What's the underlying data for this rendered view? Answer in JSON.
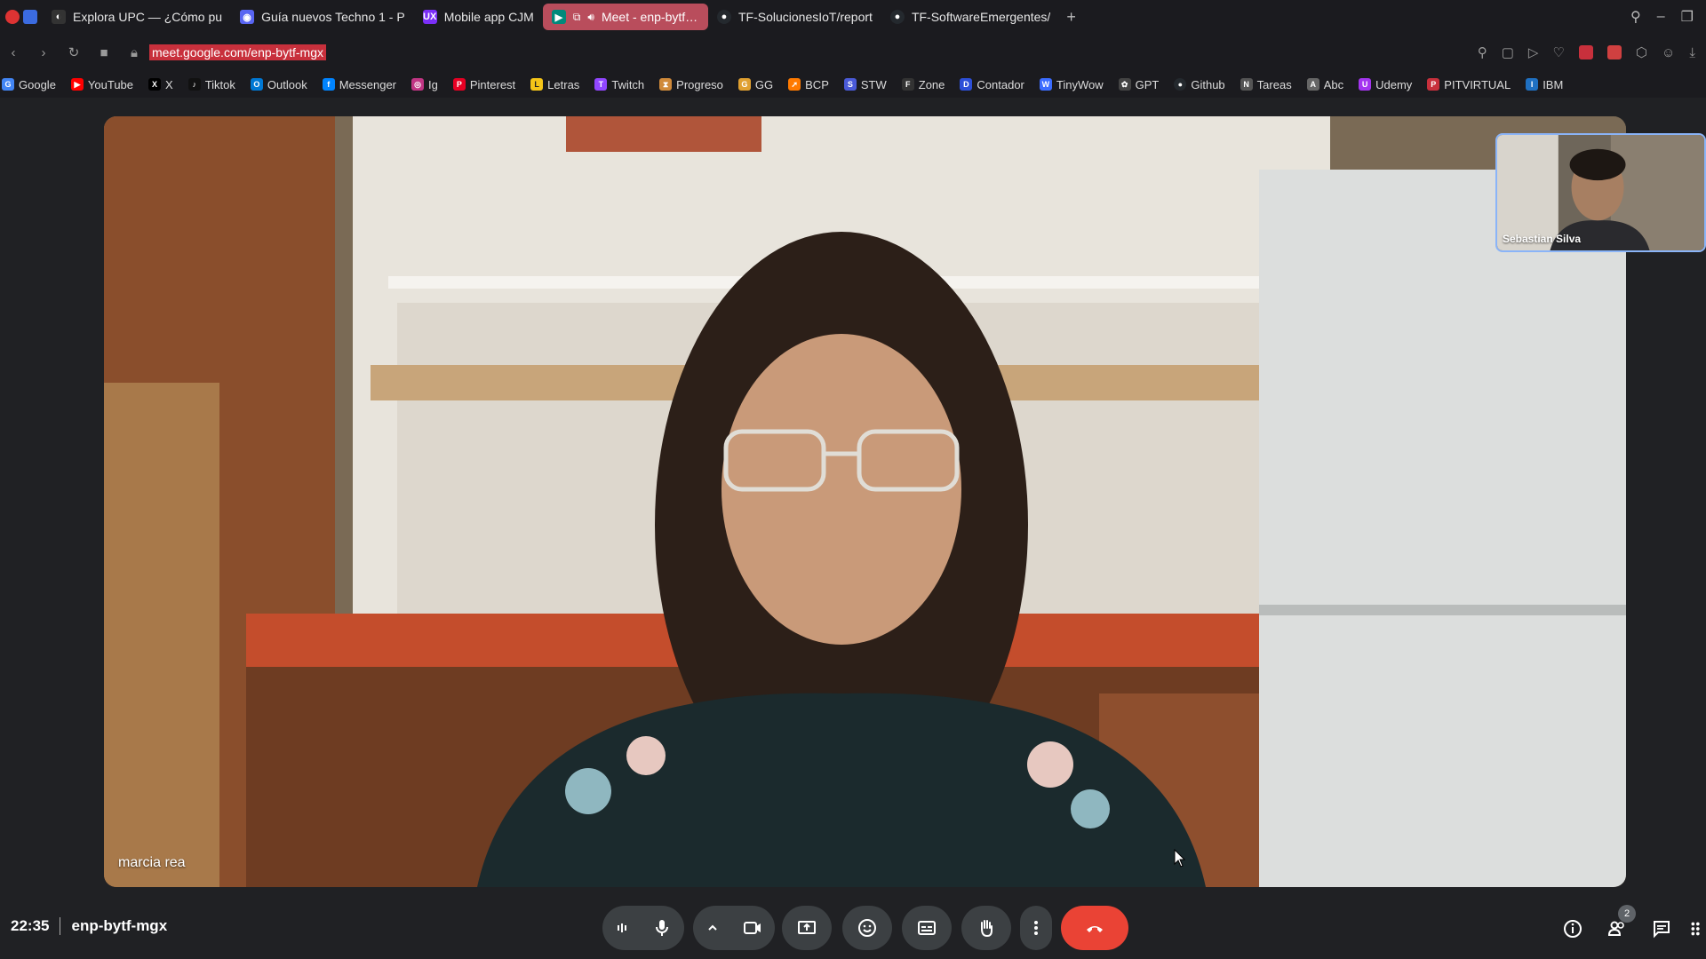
{
  "browser": {
    "tabs": [
      {
        "title": "Explora UPC — ¿Cómo pu",
        "icon": "upc-icon",
        "color": "#1a1a1a"
      },
      {
        "title": "Guía nuevos Techno 1 - P",
        "icon": "discord-icon",
        "color": "#5865f2"
      },
      {
        "title": "Mobile app CJM",
        "icon": "ux-icon",
        "color": "#7b2ff7"
      },
      {
        "title": "Meet - enp-bytf-m",
        "icon": "meet-icon",
        "color": "#00897b",
        "active": true
      },
      {
        "title": "TF-SolucionesIoT/report",
        "icon": "github-icon",
        "color": "#24292e"
      },
      {
        "title": "TF-SoftwareEmergentes/",
        "icon": "github-icon",
        "color": "#24292e"
      }
    ],
    "new_tab": "+",
    "url": "meet.google.com/enp-bytf-mgx"
  },
  "bookmarks": [
    {
      "label": "Google",
      "color": "#4285f4"
    },
    {
      "label": "YouTube",
      "color": "#ff0000"
    },
    {
      "label": "X",
      "color": "#000000"
    },
    {
      "label": "Tiktok",
      "color": "#111111"
    },
    {
      "label": "Outlook",
      "color": "#0078d4"
    },
    {
      "label": "Messenger",
      "color": "#0084ff"
    },
    {
      "label": "Ig",
      "color": "#c13584"
    },
    {
      "label": "Pinterest",
      "color": "#e60023"
    },
    {
      "label": "Letras",
      "color": "#f5c518"
    },
    {
      "label": "Twitch",
      "color": "#9146ff"
    },
    {
      "label": "Progreso",
      "color": "#d08a3a"
    },
    {
      "label": "GG",
      "color": "#e0a030"
    },
    {
      "label": "BCP",
      "color": "#ff7a00"
    },
    {
      "label": "STW",
      "color": "#4a5ad8"
    },
    {
      "label": "Zone",
      "color": "#333333"
    },
    {
      "label": "Contador",
      "color": "#2d4fd8"
    },
    {
      "label": "TinyWow",
      "color": "#3b6cff"
    },
    {
      "label": "GPT",
      "color": "#444444"
    },
    {
      "label": "Github",
      "color": "#24292e"
    },
    {
      "label": "Tareas",
      "color": "#555555"
    },
    {
      "label": "Abc",
      "color": "#666666"
    },
    {
      "label": "Udemy",
      "color": "#a435f0"
    },
    {
      "label": "PITVIRTUAL",
      "color": "#c8303c"
    },
    {
      "label": "IBM",
      "color": "#1f70c1"
    }
  ],
  "meet": {
    "main_participant": "marcia rea",
    "self_participant": "Sebastian Silva",
    "time": "22:35",
    "meeting_code": "enp-bytf-mgx",
    "participant_count": "2",
    "colors": {
      "end_call": "#ea4335",
      "control_bg": "#3c4043",
      "accent": "#8ab4f8"
    }
  }
}
